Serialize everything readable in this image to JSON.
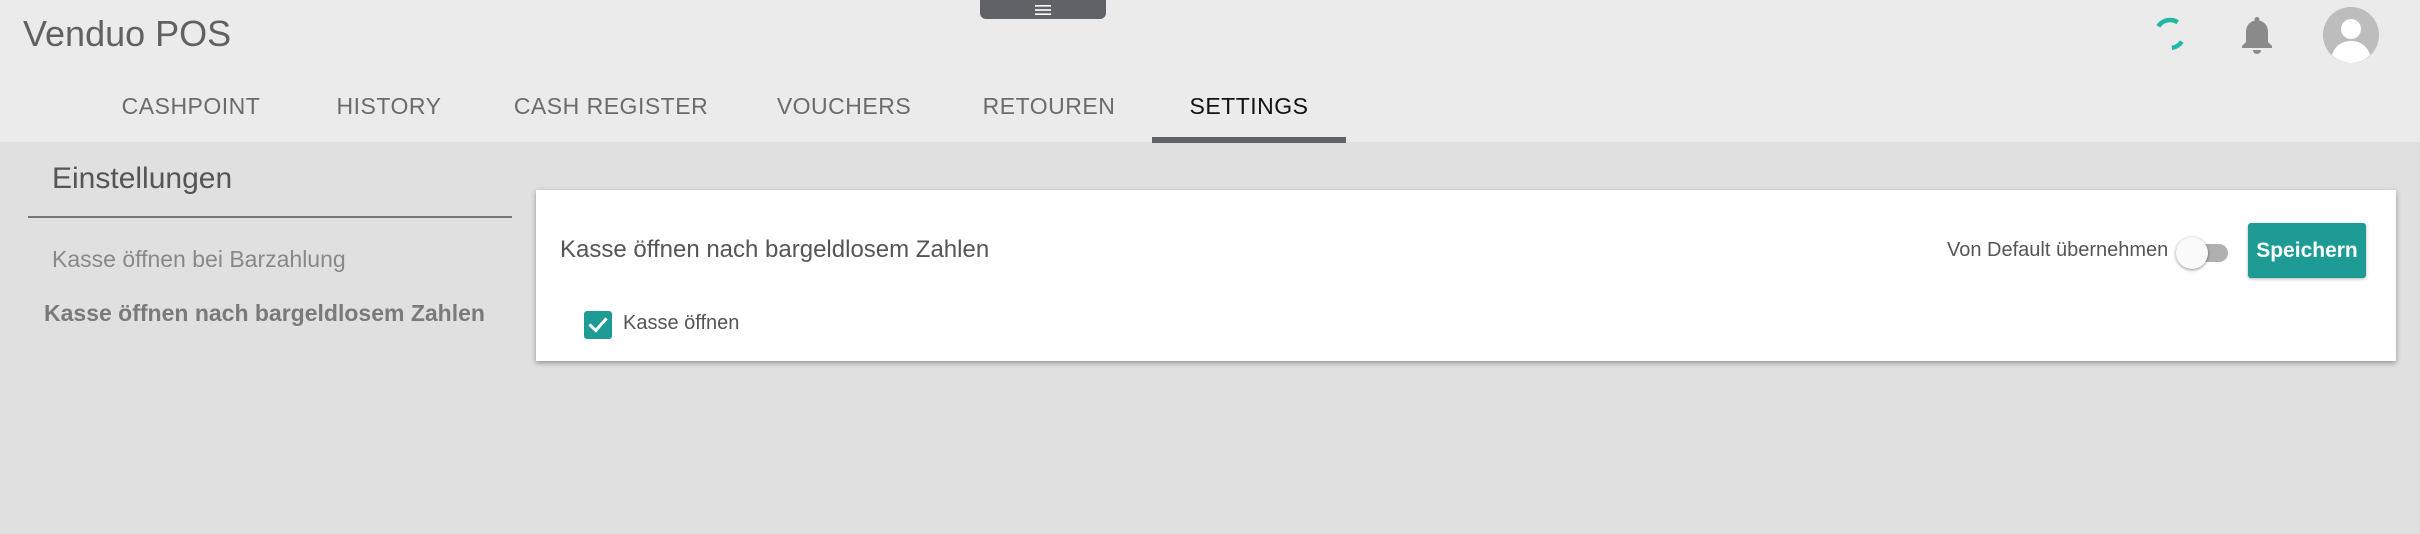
{
  "app": {
    "title": "Venduo POS"
  },
  "header": {
    "menu_icon": "menu-icon",
    "loading_icon": "loading-spinner-icon",
    "notification_icon": "bell-icon",
    "profile_icon": "user-avatar-icon"
  },
  "tabs": [
    {
      "label": "CASHPOINT",
      "active": false
    },
    {
      "label": "HISTORY",
      "active": false
    },
    {
      "label": "CASH REGISTER",
      "active": false
    },
    {
      "label": "VOUCHERS",
      "active": false
    },
    {
      "label": "RETOUREN",
      "active": false
    },
    {
      "label": "SETTINGS",
      "active": true
    }
  ],
  "sidebar": {
    "title": "Einstellungen",
    "items": [
      {
        "label": "Kasse öffnen bei Barzahlung",
        "active": false
      },
      {
        "label": "Kasse öffnen nach bargeldlosem Zahlen",
        "active": true
      }
    ]
  },
  "panel": {
    "title": "Kasse öffnen nach bargeldlosem Zahlen",
    "default_toggle": {
      "label": "Von Default übernehmen",
      "checked": false
    },
    "save_label": "Speichern",
    "checkbox": {
      "label": "Kasse öffnen",
      "checked": true
    }
  },
  "colors": {
    "accent": "#1e9b95",
    "spinner": "#21b8a6",
    "header_bg": "#ebebeb",
    "page_bg": "#e0e0e0",
    "tab_indicator": "#5f6367"
  }
}
